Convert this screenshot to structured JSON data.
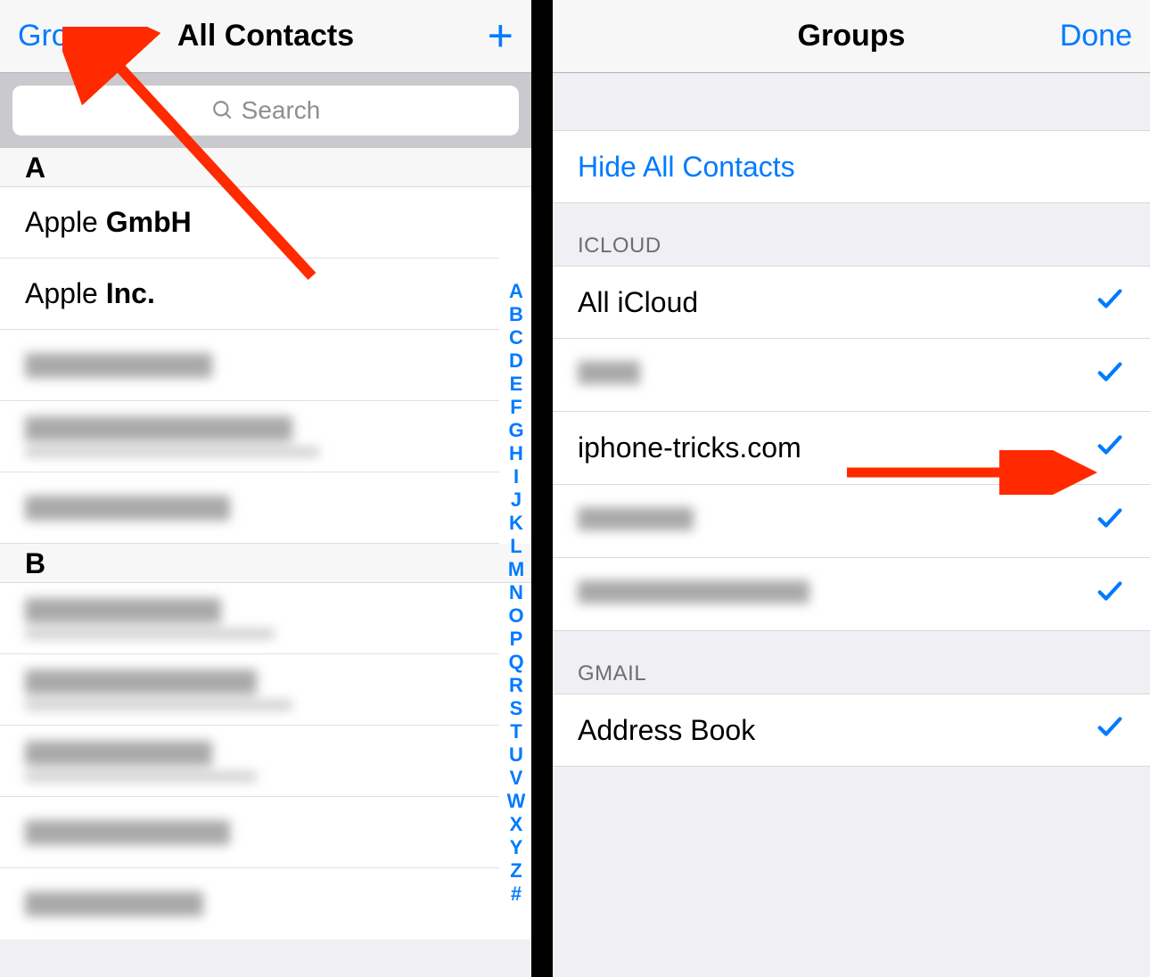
{
  "left": {
    "nav": {
      "left": "Groups",
      "title": "All Contacts"
    },
    "search_placeholder": "Search",
    "sections": [
      {
        "letter": "A",
        "rows": [
          "Apple GmbH",
          "Apple Inc."
        ]
      },
      {
        "letter": "B",
        "rows": []
      }
    ],
    "index": [
      "A",
      "B",
      "C",
      "D",
      "E",
      "F",
      "G",
      "H",
      "I",
      "J",
      "K",
      "L",
      "M",
      "N",
      "O",
      "P",
      "Q",
      "R",
      "S",
      "T",
      "U",
      "V",
      "W",
      "X",
      "Y",
      "Z",
      "#"
    ]
  },
  "right": {
    "nav": {
      "title": "Groups",
      "right": "Done"
    },
    "hide_all": "Hide All Contacts",
    "sections": [
      {
        "header": "ICLOUD",
        "rows": [
          {
            "label": "All iCloud",
            "checked": true,
            "redacted": false
          },
          {
            "label": "████",
            "checked": true,
            "redacted": true
          },
          {
            "label": "iphone-tricks.com",
            "checked": true,
            "redacted": false
          },
          {
            "label": "███████",
            "checked": true,
            "redacted": true
          },
          {
            "label": "██████████████",
            "checked": true,
            "redacted": true
          }
        ]
      },
      {
        "header": "GMAIL",
        "rows": [
          {
            "label": "Address Book",
            "checked": true,
            "redacted": false
          }
        ]
      }
    ]
  }
}
